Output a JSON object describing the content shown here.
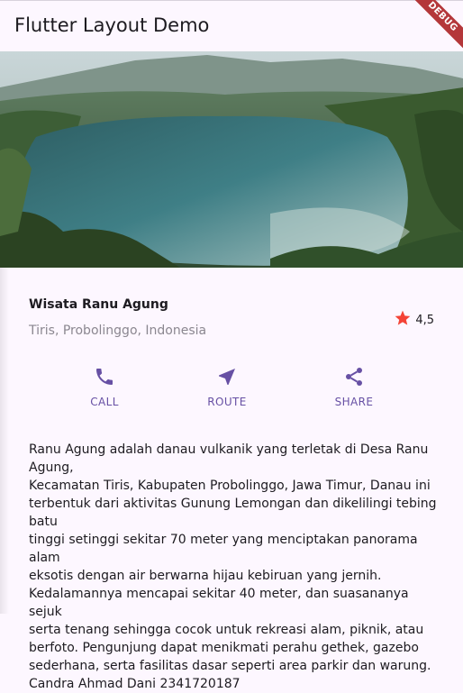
{
  "appbar": {
    "title": "Flutter Layout Demo",
    "debug_banner": "DEBUG"
  },
  "hero": {
    "image_alt": "lake-photo"
  },
  "place": {
    "name": "Wisata Ranu Agung",
    "location": "Tiris, Probolinggo, Indonesia",
    "rating": "4,5",
    "star_color": "#f44336"
  },
  "actions": [
    {
      "label": "CALL",
      "icon": "phone-icon"
    },
    {
      "label": "ROUTE",
      "icon": "navigation-icon"
    },
    {
      "label": "SHARE",
      "icon": "share-icon"
    }
  ],
  "accent_color": "#6750a4",
  "description": "Ranu Agung adalah danau vulkanik yang terletak di Desa Ranu Agung,\nKecamatan Tiris, Kabupaten Probolinggo, Jawa Timur, Danau ini\nterbentuk dari aktivitas Gunung Lemongan dan dikelilingi tebing batu\ntinggi setinggi sekitar 70 meter yang menciptakan panorama alam\neksotis dengan air berwarna hijau kebiruan yang jernih.\nKedalamannya mencapai sekitar 40 meter, dan suasananya sejuk\nserta tenang sehingga cocok untuk rekreasi alam, piknik, atau\nberfoto. Pengunjung dapat menikmati perahu gethek, gazebo\nsederhana, serta fasilitas dasar seperti area parkir dan warung.\nCandra Ahmad Dani 2341720187"
}
